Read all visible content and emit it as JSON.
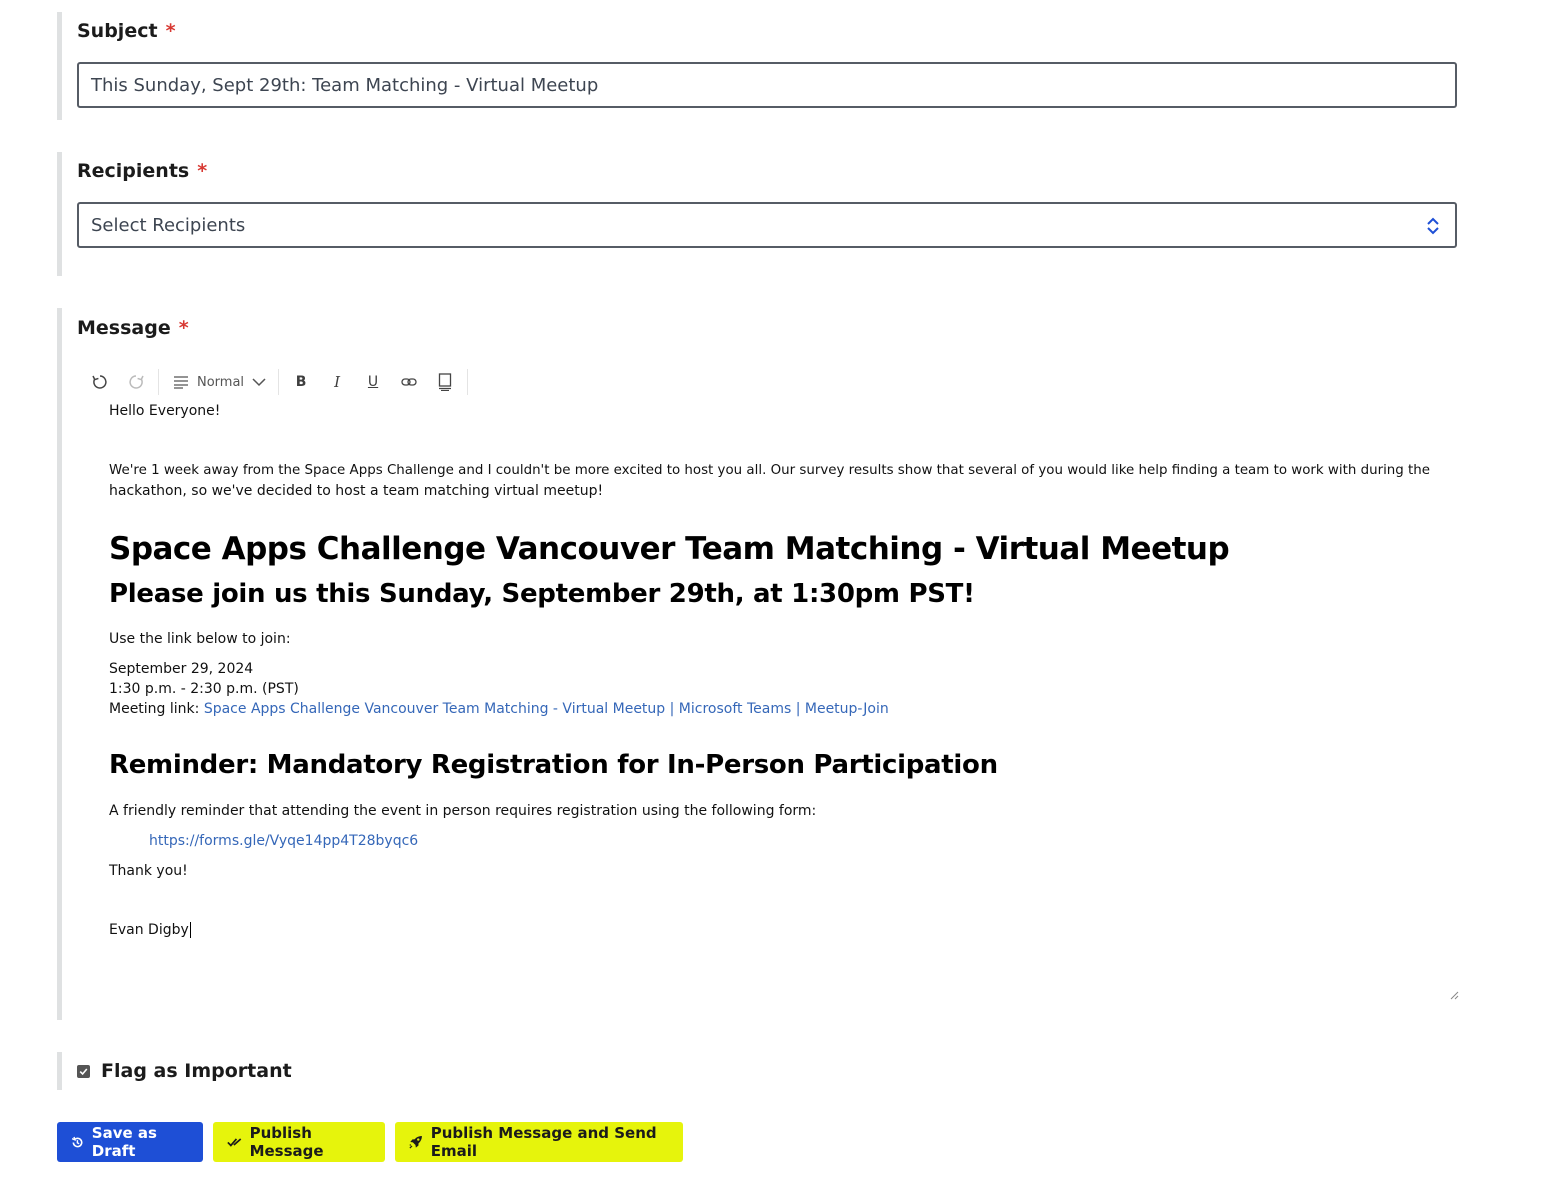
{
  "subject": {
    "label": "Subject",
    "required_mark": "*",
    "value": "This Sunday, Sept 29th: Team Matching - Virtual Meetup"
  },
  "recipients": {
    "label": "Recipients",
    "required_mark": "*",
    "placeholder": "Select Recipients"
  },
  "message": {
    "label": "Message",
    "required_mark": "*",
    "toolbar": {
      "undo_icon": "undo-icon",
      "redo_icon": "redo-icon",
      "format_label": "Normal",
      "bold_label": "B",
      "italic_label": "I",
      "underline_label": "U"
    },
    "body": {
      "greeting": "Hello Everyone!",
      "intro_line1": "We're 1 week away from the Space Apps Challenge and I couldn't be more excited to host you all. Our survey results show that several of you would like help finding a team to work with during the",
      "intro_line2": "hackathon, so we've decided to host a team matching virtual meetup!",
      "heading1": "Space Apps Challenge Vancouver Team Matching - Virtual Meetup",
      "heading2": "Please join us this Sunday, September 29th, at 1:30pm PST!",
      "use_link": "Use the link below to join:",
      "date": "September 29, 2024",
      "time": "1:30 p.m. - 2:30 p.m. (PST)",
      "meeting_label": "Meeting link: ",
      "meeting_link_text": "Space Apps Challenge Vancouver Team Matching - Virtual Meetup | Microsoft Teams | Meetup-Join",
      "reminder_heading": "Reminder: Mandatory Registration for In-Person Participation",
      "reminder_text": "A friendly reminder that attending the event in person requires registration using the following form:",
      "form_link": "https://forms.gle/Vyqe14pp4T28byqc6",
      "thanks": "Thank you!",
      "signature": "Evan Digby"
    }
  },
  "flag": {
    "label": "Flag as Important",
    "checked": true
  },
  "actions": {
    "save_draft": "Save as Draft",
    "publish": "Publish Message",
    "publish_email": "Publish Message and Send Email"
  },
  "colors": {
    "required": "#d83933",
    "primary_blue": "#1e4fd6",
    "accent_yellow": "#e6f40c",
    "link": "#3567b8"
  }
}
